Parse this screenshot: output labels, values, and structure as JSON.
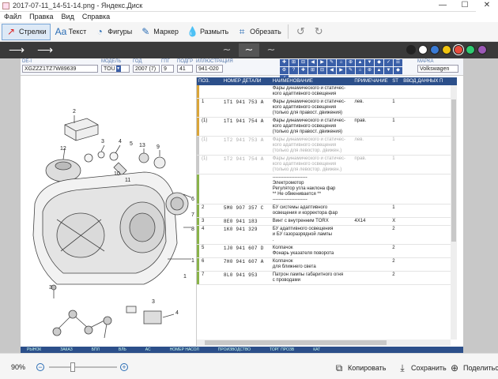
{
  "window": {
    "title": "2017-07-11_14-51-14.png - Яндекс.Диск",
    "minimize_glyph": "—",
    "maximize_glyph": "☐",
    "close_glyph": "✕"
  },
  "menu": [
    "Файл",
    "Правка",
    "Вид",
    "Справка"
  ],
  "toolbar": {
    "tools": [
      {
        "label": "Стрелки",
        "icon": "arrow-icon",
        "glyph": "↗"
      },
      {
        "label": "Текст",
        "icon": "text-icon",
        "glyph": "Aa"
      },
      {
        "label": "Фигуры",
        "icon": "shapes-icon",
        "glyph": "◔"
      },
      {
        "label": "Маркер",
        "icon": "marker-icon",
        "glyph": "✎"
      },
      {
        "label": "Размыть",
        "icon": "blur-icon",
        "glyph": "💧"
      },
      {
        "label": "Обрезать",
        "icon": "crop-icon",
        "glyph": "⌗"
      }
    ],
    "undo_glyph": "↺",
    "redo_glyph": "↻"
  },
  "stylebar": {
    "arrow_glyph": "⟶",
    "wave_glyph": "∼",
    "colors": [
      "#222222",
      "#ffffff",
      "#3a7bd5",
      "#f1c40f",
      "#e84c3d",
      "#2ecc71",
      "#9b59b6"
    ],
    "selected_color": "#e84c3d"
  },
  "catalog": {
    "fields": [
      {
        "label": "DE-I",
        "value": "XGZZZ1TZ7W89639"
      },
      {
        "label": "МОДЕЛЬ",
        "value": "TOU"
      },
      {
        "label": "ГОД",
        "value": "2007 (7)"
      },
      {
        "label": "ГПГ",
        "value": "9"
      },
      {
        "label": "ПОДГР",
        "value": "41"
      },
      {
        "label": "ИЛЛЮСТРАЦИЯ",
        "value": "941-020"
      },
      {
        "label": "МАРКА",
        "value": "Volkswagen"
      }
    ],
    "columns": [
      "ПОЗ.",
      "НОМЕР ДЕТАЛИ",
      "НАИМЕНОВАНИЕ",
      "ПРИМЕЧАНИЕ",
      "ST",
      "ВВОД ДАННЫХ П"
    ],
    "rows": [
      {
        "pos": "",
        "part": "",
        "name": "Фары динамического и статичес-\nкого адаптивного освещения",
        "note": "",
        "st": "",
        "color": "#d9a53a",
        "grey": false
      },
      {
        "pos": "1",
        "part": "1T1 941 753 A",
        "name": "Фары динамического и статичес-\nкого адаптивного освещения\n(только для правост. движения)",
        "note": "лев.",
        "st": "1",
        "color": "#d9a53a",
        "grey": false
      },
      {
        "pos": "(1)",
        "part": "1T1 941 754 A",
        "name": "Фары динамического и статичес-\nкого адаптивного освещения\n(только для правост. движения)",
        "note": "прав.",
        "st": "1",
        "color": "#d9a53a",
        "grey": false
      },
      {
        "pos": "(1)",
        "part": "1T2 941 753 A",
        "name": "Фары динамического и статичес-\nкого адаптивного освещения\n(только для левостор. движен.)",
        "note": "лев.",
        "st": "1",
        "color": "#c9c9c9",
        "grey": true
      },
      {
        "pos": "(1)",
        "part": "1T2 941 754 A",
        "name": "Фары динамического и статичес-\nкого адаптивного освещения\n(только для левостор. движен.)",
        "note": "прав.",
        "st": "1",
        "color": "#c9c9c9",
        "grey": true
      },
      {
        "pos": "",
        "part": "",
        "name": "----------------------\nЭлектромотор\nРегулятор угла наклона фар\n** Не обменивается **\n----------------------",
        "note": "",
        "st": "",
        "color": "#8ab34a",
        "grey": false
      },
      {
        "pos": "2",
        "part": "5M0 907 357 C",
        "name": "БУ системы адаптивного\nосвещения и корректора фар",
        "note": "",
        "st": "1",
        "color": "#8ab34a",
        "grey": false
      },
      {
        "pos": "3",
        "part": "8E0 941 183",
        "name": "Винт с внутренним TORX",
        "note": "4X14",
        "st": "X",
        "color": "#8ab34a",
        "grey": false
      },
      {
        "pos": "4",
        "part": "1K0 941 329",
        "name": "БУ адаптивного освещения\nи БУ газоразрядной лампы\n.",
        "note": "",
        "st": "2",
        "color": "#8ab34a",
        "grey": false
      },
      {
        "pos": "5",
        "part": "1J0 941 607 D",
        "name": "Колпачок\nФонарь указателя поворота",
        "note": "",
        "st": "2",
        "color": "#8ab34a",
        "grey": false
      },
      {
        "pos": "6",
        "part": "7H0 941 607 A",
        "name": "Колпачок\nдля ближнего света",
        "note": "",
        "st": "2",
        "color": "#8ab34a",
        "grey": false
      },
      {
        "pos": "7",
        "part": "8L0 941 953",
        "name": "Патрон лампы габаритного огня\nс проводами",
        "note": "",
        "st": "2",
        "color": "#8ab34a",
        "grey": false
      }
    ],
    "footer": [
      "РЫНОК",
      "ЗАКАЗ",
      "БПЛ",
      "ВЛЬ",
      "АС",
      "НОМЕР НАСОЛ",
      "ПРОИЗВОДСТВО",
      "ТОРГ ПРОЗВ",
      "КАТ"
    ],
    "callouts": [
      "2",
      "3",
      "4",
      "5",
      "6",
      "7",
      "8",
      "9",
      "10",
      "11",
      "12",
      "13",
      "1",
      "1",
      "3",
      "4",
      "3"
    ]
  },
  "statusbar": {
    "zoom": "90%",
    "zoom_out_glyph": "−",
    "zoom_in_glyph": "+",
    "copy_label": "Копировать",
    "save_label": "Сохранить",
    "share_label": "Поделиться"
  }
}
